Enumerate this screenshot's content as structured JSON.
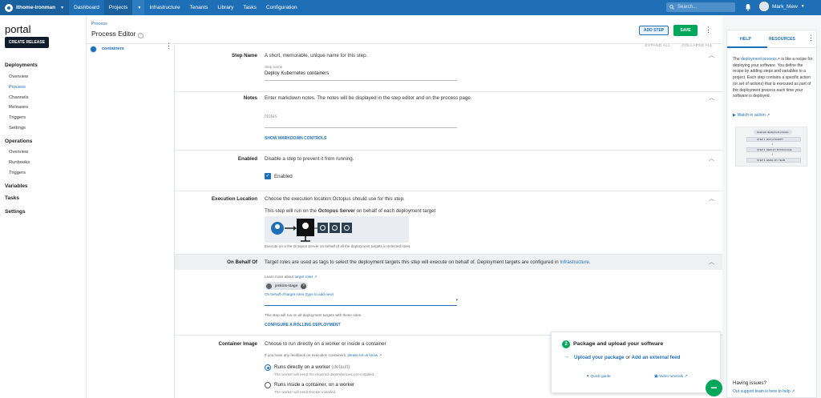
{
  "nav": {
    "space": "ithome-ironman",
    "links": [
      "Dashboard",
      "Projects",
      "Infrastructure",
      "Tenants",
      "Library",
      "Tasks",
      "Configuration"
    ],
    "search_placeholder": "Search...",
    "user": "Mark_Mew",
    "accent": "#1f6fb6"
  },
  "sidebar": {
    "project": "portal",
    "create_release": "CREATE RELEASE",
    "deployments_heading": "Deployments",
    "deployments_items": [
      "Overview",
      "Process",
      "Channels",
      "Releases",
      "Triggers",
      "Settings"
    ],
    "operations_heading": "Operations",
    "operations_items": [
      "Overview",
      "Runbooks",
      "Triggers"
    ],
    "variables": "Variables",
    "tasks": "Tasks",
    "settings": "Settings"
  },
  "header": {
    "breadcrumb": "Process",
    "title": "Process Editor",
    "add_step": "ADD STEP",
    "save": "SAVE"
  },
  "steplist": {
    "step_title": "containers"
  },
  "main": {
    "expand_all": "EXPAND ALL",
    "collapse_all": "COLLAPSE ALL",
    "step_name": {
      "label": "Step Name",
      "desc": "A short, memorable, unique name for this step.",
      "caption": "Step name",
      "value": "Deploy Kubernetes containers"
    },
    "notes": {
      "label": "Notes",
      "desc": "Enter markdown notes. The notes will be displayed in the step editor and on the process page.",
      "placeholder": "Notes",
      "action": "SHOW MARKDOWN CONTROLS"
    },
    "enabled": {
      "label": "Enabled",
      "desc": "Disable a step to prevent it from running.",
      "checkbox_label": "Enabled"
    },
    "execution": {
      "label": "Execution Location",
      "desc": "Choose the execution location Octopus should use for this step.",
      "run_prefix": "This step will run on the ",
      "run_bold": "Octopus Server",
      "run_suffix": " on behalf of each deployment target",
      "diagram_caption": "Execute on a the Octopus Server on behalf of all the deployment targets in selected roles."
    },
    "behalf": {
      "label": "On Behalf Of",
      "desc_prefix": "Target roles are used as tags to select the deployment targets this step will execute on behalf of. Deployment targets are configured in ",
      "desc_link": "Infrastructure",
      "desc_suffix": ".",
      "learn_prefix": "Learn more about ",
      "learn_link": "target roles",
      "chip": "jenkins-stage",
      "field_caption": "On behalf of target roles (type to add new)",
      "note": "This step will run on all deployment targets with these roles.",
      "action": "CONFIGURE A ROLLING DEPLOYMENT"
    },
    "container": {
      "label": "Container Image",
      "desc": "Choose to run directly on a worker or inside a container",
      "feedback_prefix": "If you have any feedback on execution containers, ",
      "feedback_link": "please let us know",
      "option1": "Runs directly on a worker",
      "option1_suffix": "(default)",
      "option1_hint": "The worker will need the required dependencies pre-installed.",
      "option2": "Runs inside a container, on a worker",
      "option2_hint": "The worker will need Docker installed."
    }
  },
  "getting_started": {
    "step_number": "2",
    "title": "Package and upload your software",
    "link1": "Upload your package",
    "or": " or ",
    "link2": "Add an external feed",
    "quick_guide": "Quick guide",
    "video": "Video tutorials"
  },
  "help": {
    "tab_help": "HELP",
    "tab_resources": "RESOURCES",
    "text_prefix": "The ",
    "text_link": "deployment process",
    "text_body": " is like a recipe for deploying your software. You define the recipe by adding steps and variables to a project. Each step contains a specific action (or set of actions) that is executed as part of the deployment process each time your software is deployed.",
    "watch": "Watch in action",
    "image_header": "Example deployment process",
    "image_steps": [
      "STEP 1. RUN A SCRIPT",
      "STEP 2. DEPLOY MYPACKAGE",
      "STEP 3. EMAIL MY TEAM"
    ],
    "footer_title": "Having issues?",
    "footer_link": "Our support team is here to help"
  }
}
